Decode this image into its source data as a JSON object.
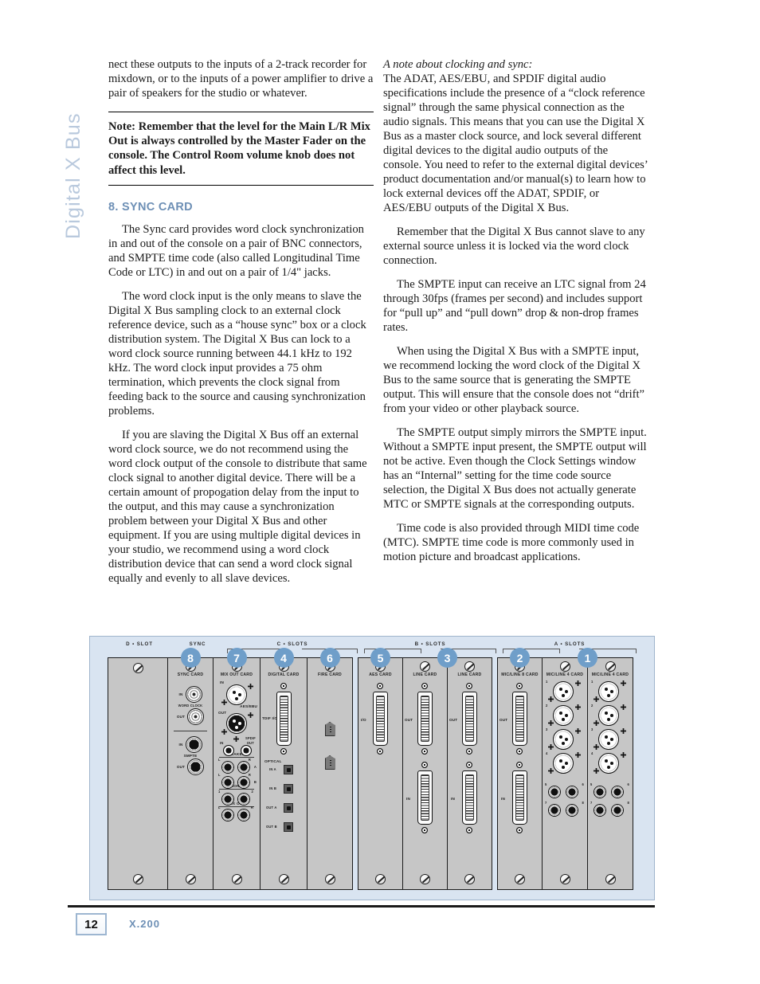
{
  "running_head": "Digital X Bus",
  "colors": {
    "accent_blue": "#6d8fb5",
    "badge_blue": "#6f9ec9",
    "panel_bg": "#d9e4f1",
    "card_gray": "#c6c6c6",
    "running_head_blue": "#b9c9dd"
  },
  "left_column": {
    "continued_paragraph": "nect these outputs to the inputs of a 2-track recorder for mixdown, or to the inputs of a power amplifier to drive a pair of speakers for the studio or whatever.",
    "note": {
      "label": "Note:",
      "text": " Remember that the level for the Main L/R Mix Out is always controlled by the Master Fader on the console. The Control Room volume knob does not affect this level."
    },
    "section_heading": "8. SYNC CARD",
    "paragraphs": [
      "The Sync card provides word clock synchronization in and out of the console on a pair of BNC connectors, and SMPTE  time code (also called Longitudinal Time Code or LTC) in and out on a pair of 1/4\" jacks.",
      "The word clock input is the only means to slave the Digital X Bus sampling clock to an external clock reference device, such as a “house sync” box or a clock distribution system. The Digital X Bus can lock to a word clock source running between 44.1 kHz to 192 kHz. The word clock input provides a 75 ohm termination, which prevents the clock signal from feeding back to the source and causing synchronization problems.",
      "If you are slaving the Digital X Bus off an external word clock source, we do not recommend using the word clock output of the console to distribute that same clock signal to another digital device. There will be a certain amount of propogation delay from the input to the output, and this may cause a synchronization problem between your Digital X Bus and other equipment. If you are using multiple digital devices in your studio, we recommend using a word clock distribution device that can send a word clock signal equally and evenly to all slave devices."
    ]
  },
  "right_column": {
    "italic_heading": "A note about clocking and sync:",
    "paragraphs": [
      "The ADAT, AES/EBU, and SPDIF digital audio specifications include the presence of a “clock reference signal” through the same physical connection as the audio signals. This means that you can use the Digital X Bus as a master clock source, and lock several different digital devices to the digital audio outputs of the console. You need to refer to the external digital devices’ product documentation and/or manual(s) to learn how to lock external devices off the ADAT, SPDIF, or AES/EBU outputs of the Digital X Bus.",
      "Remember that the Digital X Bus cannot slave to any external source unless it is locked via the word clock connection.",
      "The SMPTE input can receive an LTC signal from 24 through 30fps (frames per second) and includes support for “pull up” and “pull down” drop & non-drop frames rates.",
      "When using the Digital X Bus with a SMPTE input, we recommend locking the word clock of the Digital X Bus to the same source that is generating the SMPTE output. This will ensure that the console does not “drift” from your video or other playback source.",
      "The SMPTE output simply mirrors the SMPTE input. Without a SMPTE input present, the SMPTE output will not be active. Even though the Clock Settings window has an “Internal” setting for the time code source selection, the Digital X Bus does not actually generate MTC or SMPTE signals at the corresponding outputs.",
      "Time code is also provided through MIDI time code (MTC). SMPTE time code is more commonly used in motion picture and broadcast applications."
    ]
  },
  "diagram": {
    "slot_groups": [
      {
        "label": "D • SLOT",
        "style": "plain"
      },
      {
        "label": "SYNC",
        "style": "plain"
      },
      {
        "label": "C • SLOTS",
        "style": "bracket"
      },
      {
        "label": "B • SLOTS",
        "style": "bracket"
      },
      {
        "label": "A • SLOTS",
        "style": "bracket"
      }
    ],
    "badges": [
      "8",
      "7",
      "4",
      "6",
      "5",
      "3",
      "2",
      "1"
    ],
    "cards": [
      {
        "name": "",
        "badge": null
      },
      {
        "name": "SYNC CARD",
        "badge": "8"
      },
      {
        "name": "MIX OUT CARD",
        "badge": "7"
      },
      {
        "name": "DIGITAL CARD",
        "badge": "4"
      },
      {
        "name": "FIRE CARD",
        "badge": "6"
      },
      {
        "name": "AES CARD",
        "badge": "5"
      },
      {
        "name": "LINE CARD",
        "badge": null
      },
      {
        "name": "LINE CARD",
        "badge": "3"
      },
      {
        "name": "MIC/LINE 8 CARD",
        "badge": "2"
      },
      {
        "name": "MIC/LINE 4 CARD",
        "badge": "1"
      },
      {
        "name": "MIC/LINE 4 CARD",
        "badge": null
      }
    ],
    "sync_card": {
      "word_clock_group": "WORD CLOCK",
      "word_clock_in": "IN",
      "word_clock_out": "OUT",
      "smpte_group": "SMPTE",
      "smpte_in": "IN",
      "smpte_out": "OUT"
    },
    "mix_out_card": {
      "aes_in": "IN",
      "aes_out": "OUT",
      "aes_label": "AES/EBU",
      "spdif_label": "SPDIF",
      "spdif_in": "IN",
      "spdif_out": "OUT",
      "speakers_group": "SPEAKERS",
      "speakers_a": "A",
      "speakers_b": "B",
      "phones_group": "PHONES",
      "phones_1": "1",
      "phones_2": "2",
      "mixout_group": "MIX OUT",
      "left": "L",
      "right": "R"
    },
    "digital_card": {
      "tdif_label": "TDIF I/O",
      "optical_label": "OPTICAL",
      "optical_ports": [
        "IN A",
        "IN B",
        "OUT A",
        "OUT B"
      ]
    },
    "aes_card": {
      "io_label": "I/O"
    },
    "line_card": {
      "out_label": "OUT",
      "in_label": "IN"
    },
    "mic_line_8_card": {
      "out_label": "OUT",
      "in_label": "IN"
    },
    "mic_line_4_card": {
      "xlr_numbers": [
        "1",
        "2",
        "3",
        "4"
      ],
      "trs_numbers": [
        "5",
        "6",
        "7",
        "8"
      ]
    }
  },
  "footer": {
    "page_number": "12",
    "product": "X.200"
  }
}
